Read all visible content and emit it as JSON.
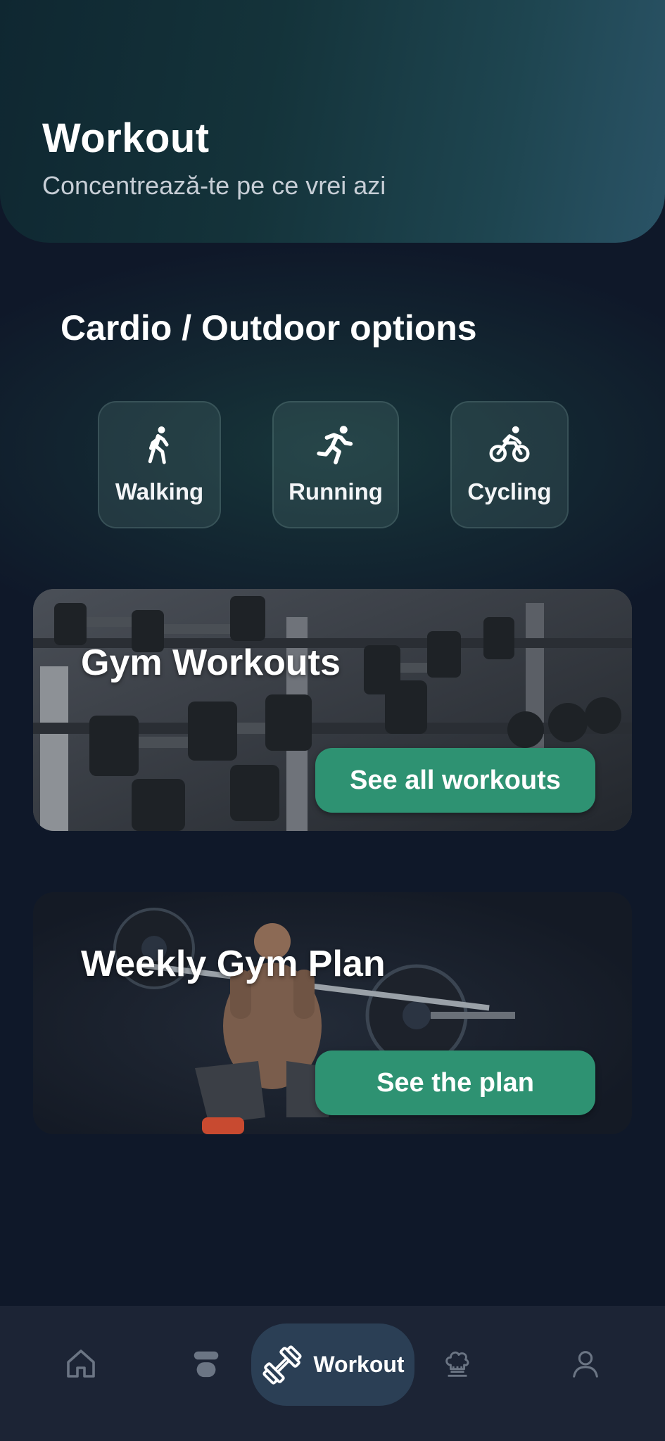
{
  "header": {
    "title": "Workout",
    "subtitle": "Concentrează-te pe ce vrei azi"
  },
  "cardio": {
    "section_title": "Cardio / Outdoor options",
    "options": [
      {
        "label": "Walking",
        "icon": "walking-icon"
      },
      {
        "label": "Running",
        "icon": "running-icon"
      },
      {
        "label": "Cycling",
        "icon": "cycling-icon"
      }
    ]
  },
  "gym_card": {
    "title": "Gym Workouts",
    "button_label": "See all workouts"
  },
  "plan_card": {
    "title": "Weekly Gym Plan",
    "button_label": "See the plan"
  },
  "bottom_nav": {
    "items": [
      {
        "icon": "home-icon"
      },
      {
        "icon": "nutrition-icon"
      },
      {
        "icon": "dumbbell-icon",
        "label": "Workout",
        "active": true
      },
      {
        "icon": "chef-icon"
      },
      {
        "icon": "profile-icon"
      }
    ]
  },
  "colors": {
    "background": "#0f1829",
    "accent": "#2e9272",
    "nav_background": "#1c2435",
    "nav_active": "#2b3f55"
  }
}
